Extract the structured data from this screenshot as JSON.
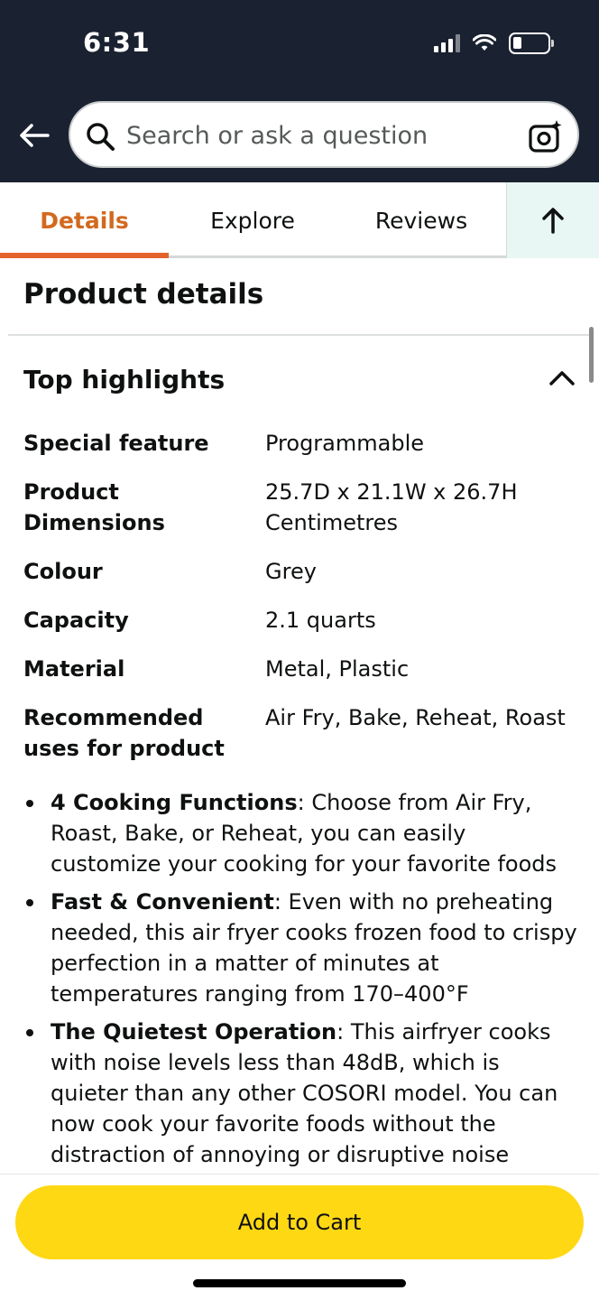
{
  "status": {
    "time": "6:31"
  },
  "search": {
    "placeholder": "Search or ask a question"
  },
  "tabs": [
    {
      "label": "Details",
      "active": true
    },
    {
      "label": "Explore",
      "active": false
    },
    {
      "label": "Reviews",
      "active": false
    }
  ],
  "section_title": "Product details",
  "highlights_title": "Top highlights",
  "specs": [
    {
      "key": "Special feature",
      "value": "Programmable"
    },
    {
      "key": "Product Dimensions",
      "value": "25.7D x 21.1W x 26.7H Centimetres"
    },
    {
      "key": "Colour",
      "value": "Grey"
    },
    {
      "key": "Capacity",
      "value": "2.1 quarts"
    },
    {
      "key": "Material",
      "value": "Metal, Plastic"
    },
    {
      "key": "Recommended uses for product",
      "value": "Air Fry, Bake, Reheat, Roast"
    }
  ],
  "bullets": [
    {
      "title": "4 Cooking Functions",
      "text": ": Choose from Air Fry, Roast, Bake, or Reheat, you can easily customize your cooking for your favorite foods"
    },
    {
      "title": "Fast & Convenient",
      "text": ": Even with no preheating needed, this air fryer cooks frozen food to crispy perfection in a matter of minutes at temperatures ranging from 170–400°F"
    },
    {
      "title": "The Quietest Operation",
      "text": ": This airfryer cooks with noise levels less than 48dB, which is quieter than any other COSORI model. You can now cook your favorite foods without the distraction of annoying or disruptive noise"
    }
  ],
  "cart": {
    "label": "Add to Cart"
  },
  "colors": {
    "header": "#1a2130",
    "accent_tab": "#e4632c",
    "cart_button": "#ffd814",
    "top_tab_bg": "#e8f7f3"
  },
  "icons": {
    "back": "arrow-left-icon",
    "search": "search-icon",
    "camera": "camera-icon",
    "scroll_top": "arrow-up-icon",
    "collapse": "chevron-up-icon"
  }
}
